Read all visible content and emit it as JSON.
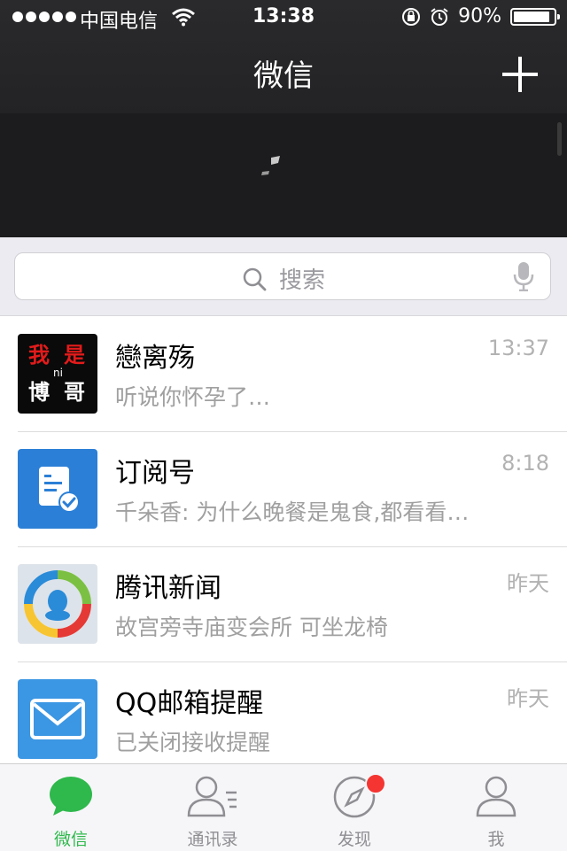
{
  "status_bar": {
    "carrier": "中国电信",
    "time": "13:38",
    "battery": "90%",
    "battery_level": 0.9
  },
  "nav": {
    "title": "微信",
    "add_icon": "plus-icon"
  },
  "search": {
    "placeholder": "搜索"
  },
  "chats": [
    {
      "name": "戀离殇",
      "time": "13:37",
      "message": "听说你怀孕了…",
      "avatar": "avatar-text-image"
    },
    {
      "name": "订阅号",
      "time": "8:18",
      "message": "千朵香: 为什么晚餐是鬼食,都看看…",
      "avatar": "subscription-icon"
    },
    {
      "name": "腾讯新闻",
      "time": "昨天",
      "message": "故宫旁寺庙变会所 可坐龙椅",
      "avatar": "tencent-news-logo"
    },
    {
      "name": "QQ邮箱提醒",
      "time": "昨天",
      "message": "已关闭接收提醒",
      "avatar": "mail-icon"
    }
  ],
  "avatar_text": {
    "tl": "我",
    "tr": "是",
    "mid": "ni",
    "bl": "博",
    "br": "哥"
  },
  "tabs": [
    {
      "label": "微信",
      "icon": "chat-bubble-icon",
      "active": true
    },
    {
      "label": "通讯录",
      "icon": "contacts-icon",
      "active": false
    },
    {
      "label": "发现",
      "icon": "compass-icon",
      "active": false,
      "badge": true
    },
    {
      "label": "我",
      "icon": "person-icon",
      "active": false
    }
  ],
  "colors": {
    "accent_green": "#2fb84c",
    "badge_red": "#f43531",
    "nav_bg": "#262628"
  }
}
